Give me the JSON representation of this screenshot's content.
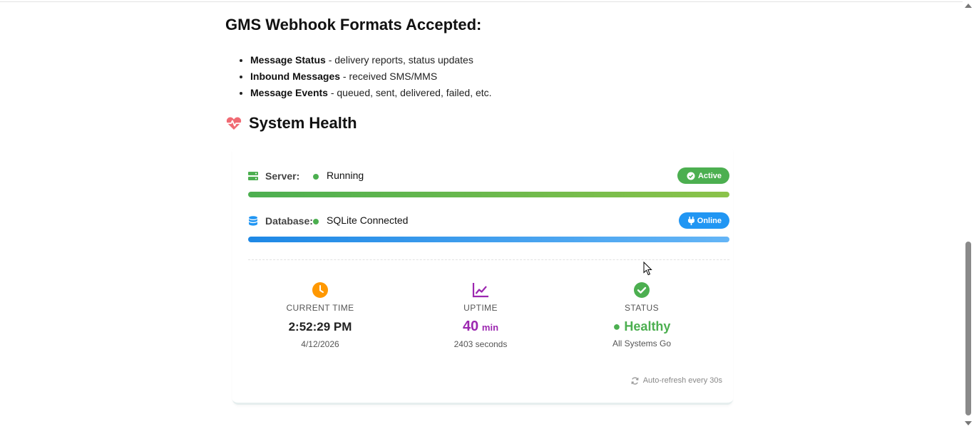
{
  "formats": {
    "title": "GMS Webhook Formats Accepted:",
    "items": [
      {
        "term": "Message Status",
        "desc": " - delivery reports, status updates"
      },
      {
        "term": "Inbound Messages",
        "desc": " - received SMS/MMS"
      },
      {
        "term": "Message Events",
        "desc": " - queued, sent, delivered, failed, etc."
      }
    ]
  },
  "health": {
    "title": "System Health",
    "icon": "heartbeat-icon",
    "server": {
      "label": "Server:",
      "value": "Running",
      "badge": "Active",
      "badge_color": "#4caf50",
      "progress": 1.0,
      "icon": "server-icon"
    },
    "database": {
      "label": "Database:",
      "value": "SQLite Connected",
      "badge": "Online",
      "badge_color": "#2196f3",
      "progress": 1.0,
      "icon": "database-icon"
    },
    "stats": {
      "time": {
        "label": "CURRENT TIME",
        "value": "2:52:29 PM",
        "sub": "4/12/2026",
        "color": "#ff9800"
      },
      "uptime": {
        "label": "UPTIME",
        "value": "40",
        "unit": "min",
        "sub": "2403 seconds",
        "color": "#9c27b0"
      },
      "status": {
        "label": "STATUS",
        "value": "● Healthy",
        "sub": "All Systems Go",
        "color": "#4caf50"
      }
    },
    "refresh_text": "Auto-refresh every 30s"
  }
}
